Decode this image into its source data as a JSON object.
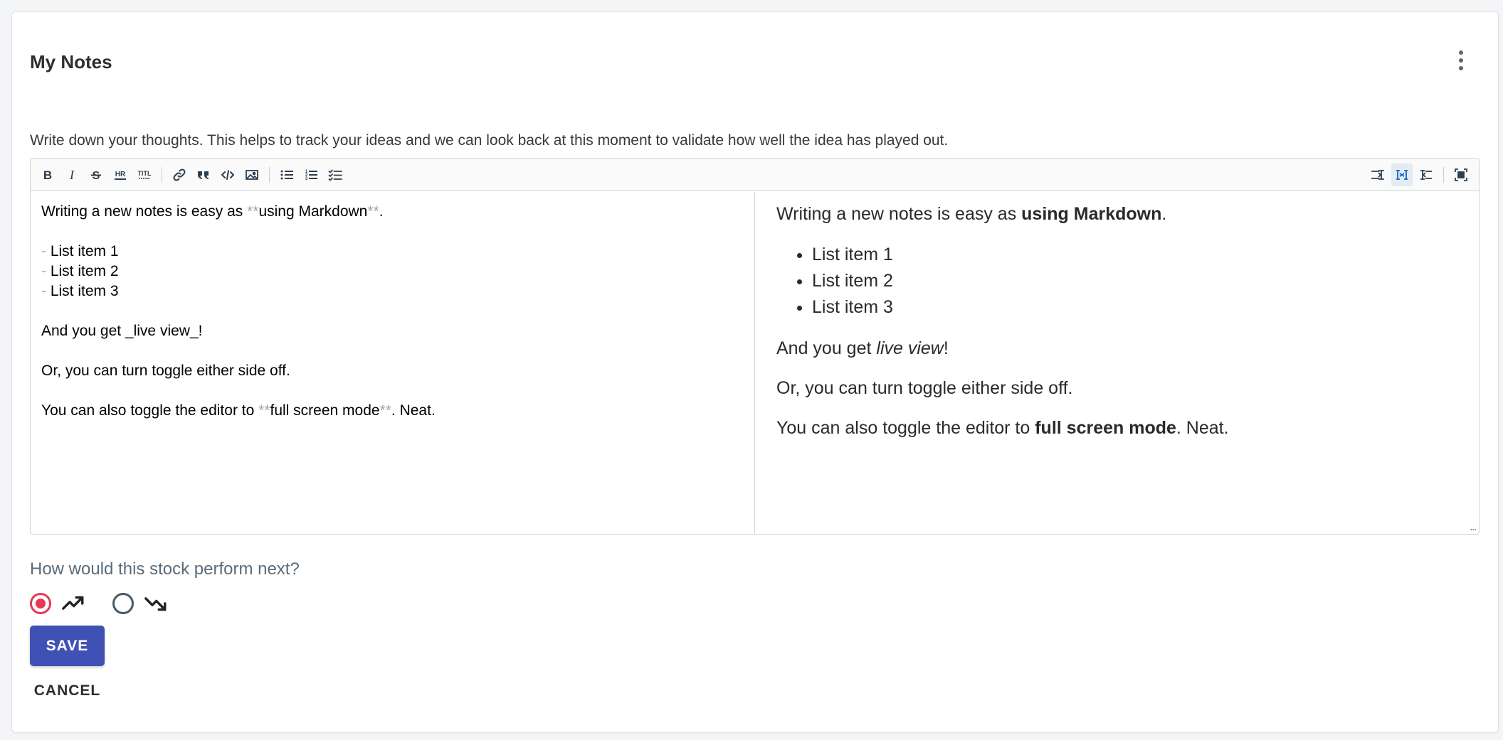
{
  "card": {
    "title": "My Notes",
    "menu_icon": "more-vert-icon",
    "description": "Write down your thoughts. This helps to track your ideas and we can look back at this moment to validate how well the idea has played out."
  },
  "toolbar": {
    "left_icons": [
      "bold-icon",
      "italic-icon",
      "strikethrough-icon",
      "horizontal-rule-icon",
      "title-icon",
      "link-icon",
      "quote-icon",
      "code-icon",
      "image-icon",
      "bullet-list-icon",
      "numbered-list-icon",
      "checklist-icon"
    ],
    "right_icons": [
      "editor-only-icon",
      "side-by-side-icon",
      "preview-only-icon",
      "fullscreen-icon"
    ],
    "active": "side-by-side-icon"
  },
  "editor": {
    "line1_a": "Writing a new notes is easy as ",
    "line1_mk1": "**",
    "line1_b": "using Markdown",
    "line1_mk2": "**",
    "line1_c": ".",
    "list_dash": "-",
    "list_items": [
      " List item 1",
      " List item 2",
      " List item 3"
    ],
    "line_live": "And you get _live view_!",
    "line_toggle": "Or, you can turn toggle either side off.",
    "line_full_a": "You can also toggle the editor to ",
    "line_full_mk1": "**",
    "line_full_b": "full screen mode",
    "line_full_mk2": "**",
    "line_full_c": ". Neat."
  },
  "preview": {
    "p1_a": "Writing a new notes is easy as ",
    "p1_b": "using Markdown",
    "p1_c": ".",
    "list_items": [
      "List item 1",
      "List item 2",
      "List item 3"
    ],
    "p2_a": "And you get ",
    "p2_b": "live view",
    "p2_c": "!",
    "p3": "Or, you can turn toggle either side off.",
    "p4_a": "You can also toggle the editor to ",
    "p4_b": "full screen mode",
    "p4_c": ". Neat.",
    "resize_grip": "..."
  },
  "question": {
    "label": "How would this stock perform next?",
    "options": [
      {
        "icon": "trending-up-icon",
        "selected": true
      },
      {
        "icon": "trending-down-icon",
        "selected": false
      }
    ],
    "selected_color": "#e53955"
  },
  "actions": {
    "save_label": "SAVE",
    "cancel_label": "CANCEL",
    "save_color": "#4051b5"
  }
}
